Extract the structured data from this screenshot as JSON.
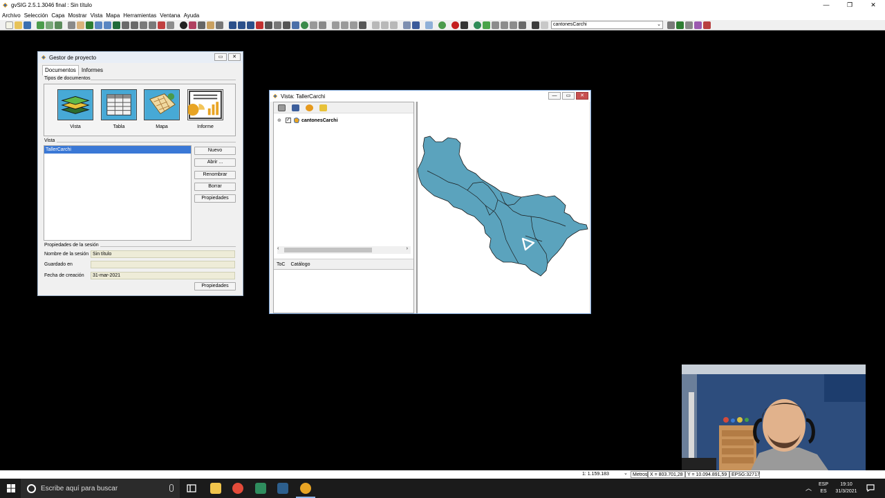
{
  "window": {
    "title": "gvSIG 2.5.1.3046 final : Sin título"
  },
  "menu": [
    "Archivo",
    "Selección",
    "Capa",
    "Mostrar",
    "Vista",
    "Mapa",
    "Herramientas",
    "Ventana",
    "Ayuda"
  ],
  "toolbar": {
    "layer_selector_value": "cantonesCarchi"
  },
  "gestor": {
    "title": "Gestor de proyecto",
    "tabs": [
      "Documentos",
      "Informes"
    ],
    "doc_types_label": "Tipos de documentos",
    "doc_types": [
      "Vista",
      "Tabla",
      "Mapa",
      "Informe"
    ],
    "list_label": "Vista",
    "list_items": [
      "TallerCarchi"
    ],
    "buttons": [
      "Nuevo",
      "Abrir ...",
      "Renombrar",
      "Borrar",
      "Propiedades"
    ],
    "session_label": "Propiedades de la sesión",
    "session": {
      "name_label": "Nombre de la sesión",
      "name_value": "Sin título",
      "saved_label": "Guardado en",
      "saved_value": "",
      "created_label": "Fecha de creación",
      "created_value": "31-mar-2021"
    },
    "session_props_button": "Propiedades"
  },
  "vista": {
    "title": "Vista: TallerCarchi",
    "layers": [
      {
        "name": "cantonesCarchi",
        "visible": true
      }
    ],
    "toc_tabs": [
      "ToC",
      "Catálogo"
    ],
    "polygon_fill": "#5ba3bd"
  },
  "statusbar": {
    "scale": "1: 1.159.183",
    "units": "Metros",
    "x": "X = 803.701,28",
    "y": "Y = 10.094.891,59",
    "epsg": "EPSG:32717"
  },
  "taskbar": {
    "search_placeholder": "Escribe aquí para buscar",
    "lang_top": "ESP",
    "lang_bottom": "ES",
    "time": "19:10",
    "date": "31/3/2021"
  }
}
